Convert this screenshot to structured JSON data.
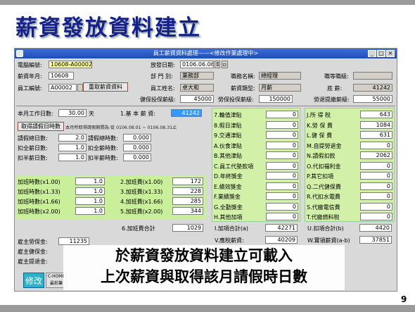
{
  "slide": {
    "title": "薪資發放資料建立",
    "caption_line1": "於薪資發放資料建立可載入",
    "caption_line2": "上次薪資與取得該月請假時日數",
    "page_number": "9"
  },
  "window": {
    "title": "員工薪資資料處理——<修改作業處理中>",
    "min": "_",
    "max": "□",
    "close": "×"
  },
  "header": {
    "doc_no_label": "電腦編號:",
    "doc_no": "10608-A00002",
    "pay_date_label": "放發日期:",
    "pay_date": "0106.06.06",
    "pay_month_label": "薪資年月:",
    "pay_month": "10608",
    "dept_label": "部 門 別:",
    "dept": "業務部",
    "job_title_label": "職務名稱:",
    "job_title": "總經理",
    "grade_label": "職等職級:",
    "grade": "",
    "emp_no_label": "員工編號:",
    "emp_no": "A00002",
    "reload_button": "重取薪資資料",
    "emp_name_label": "員工姓名:",
    "emp_name": "卓大和",
    "pay_type_label": "薪資類型:",
    "pay_type": "月薪",
    "base_total_label": "底     薪:",
    "base_total": "41242",
    "health_level_label": "健保投保薪級:",
    "health_level": "45000",
    "labor_level_label": "勞保投保薪級:",
    "labor_level": "150000",
    "pension_level_label": "勞退提繳薪級:",
    "pension_level": "55000"
  },
  "left": {
    "workdays_label": "本月工作日數:",
    "workdays": "30.00",
    "workdays_unit": "天",
    "leave_button": "取得請假日時數",
    "leave_note": "本月所取得請假期間為:從 0106.08.01 ~ 0106.08.31止",
    "leave_rows": [
      {
        "label": "請假總日數:",
        "value": "2.0",
        "label2": "請假總時數:",
        "value2": "0.000"
      },
      {
        "label": "扣全薪日數:",
        "value": "1.0",
        "label2": "扣全薪時數:",
        "value2": "0.000"
      },
      {
        "label": "扣半薪日數:",
        "value": "1.0",
        "label2": "扣半薪時數:",
        "value2": "0.000"
      }
    ],
    "ot_rows": [
      {
        "label": "加班時數(x1.00)",
        "value": "1.0",
        "label2": "2.加班費(x1.00)",
        "value2": "172"
      },
      {
        "label": "加班時數(x1.33)",
        "value": "1.0",
        "label2": "3.加班費(x1.33)",
        "value2": "228"
      },
      {
        "label": "加班時數(x1.66)",
        "value": "1.0",
        "label2": "4.加班費(x1.66)",
        "value2": "285"
      },
      {
        "label": "加班時數(x2.00)",
        "value": "1.0",
        "label2": "5.加班費(x2.00)",
        "value2": "344"
      }
    ],
    "ot_total_label": "6.加班費合計",
    "ot_total": "1029",
    "employer_labor_label": "雇主勞保金:",
    "employer_labor": "11235",
    "employer_health_label": "雇主健保金:",
    "employer_pension_label": "雇主提退金:"
  },
  "middle": {
    "base_label": "1.基 本 薪 資:",
    "base": "41242",
    "allowances": [
      {
        "label": "7.輪值津貼",
        "value": "0"
      },
      {
        "label": "8.假日津貼",
        "value": "0"
      },
      {
        "label": "9.交通津貼",
        "value": "0"
      },
      {
        "label": "A.伙食津貼",
        "value": "0"
      },
      {
        "label": "B.其他津貼",
        "value": "0"
      },
      {
        "label": "C.員工代墊款項",
        "value": "0"
      },
      {
        "label": "D.年終獎金",
        "value": "0"
      },
      {
        "label": "E.績效獎金",
        "value": "0"
      },
      {
        "label": "F.業績獎金",
        "value": "0"
      },
      {
        "label": "G.全勤獎金",
        "value": "0"
      },
      {
        "label": "H.其他加項",
        "value": "0"
      }
    ],
    "add_total_label": "I.加項合計(a)",
    "add_total": "42271",
    "taxable_label": "V.應稅薪資:",
    "taxable": "40209"
  },
  "right": {
    "deductions": [
      {
        "label": "J.所 得 稅",
        "value": "643"
      },
      {
        "label": "K.勞 保 費",
        "value": "1084"
      },
      {
        "label": "L.健 保 費",
        "value": "631"
      },
      {
        "label": "M.自提勞退金",
        "value": "0"
      },
      {
        "label": "N.請假扣款",
        "value": "2062"
      },
      {
        "label": "O.代扣福利金",
        "value": "0"
      },
      {
        "label": "P.其它扣項",
        "value": "0"
      },
      {
        "label": "Q.二代健保費",
        "value": "0"
      },
      {
        "label": "R.代扣水電費",
        "value": "0"
      },
      {
        "label": "S.代繳電信費",
        "value": "0"
      },
      {
        "label": "T.代繳燃料稅",
        "value": "0"
      }
    ],
    "deduct_total_label": "U.扣項合計(b)",
    "deduct_total": "4420",
    "net_label": "W.實領薪資(a-b)",
    "net": "37851"
  },
  "footer": {
    "modify_button": "修改",
    "home_button_line1": "C-HOME",
    "home_button_line2": "最前筆"
  }
}
